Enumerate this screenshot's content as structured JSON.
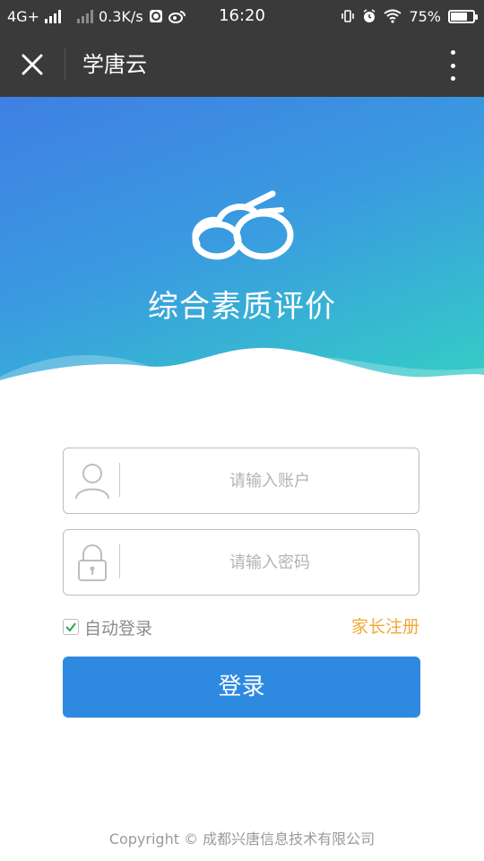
{
  "status_bar": {
    "network": "4G+",
    "speed": "0.3K/s",
    "time": "16:20",
    "battery": "75%",
    "battery_level": 0.75,
    "icons": [
      "signal-icon",
      "signal-icon",
      "browser-icon",
      "weibo-icon",
      "vibrate-icon",
      "alarm-icon",
      "wifi-icon",
      "battery-icon"
    ]
  },
  "nav": {
    "title": "学唐云",
    "close_icon": "close-icon",
    "more_icon": "more-vertical-icon"
  },
  "hero": {
    "title": "综合素质评价",
    "logo_icon": "cloud-logo-icon"
  },
  "form": {
    "account_placeholder": "请输入账户",
    "account_value": "",
    "account_icon": "user-icon",
    "password_placeholder": "请输入密码",
    "password_value": "",
    "password_icon": "lock-icon",
    "remember_label": "自动登录",
    "remember_checked": true,
    "register_label": "家长注册",
    "login_label": "登录"
  },
  "footer": {
    "copyright": "Copyright © 成都兴唐信息技术有限公司"
  },
  "colors": {
    "bar_bg": "#3a3a3a",
    "gradient_start": "#3f7fe3",
    "gradient_end": "#33d4c2",
    "primary_button": "#2e8ae0",
    "register_link": "#f0a93a",
    "checkbox_check": "#2aa84a"
  }
}
